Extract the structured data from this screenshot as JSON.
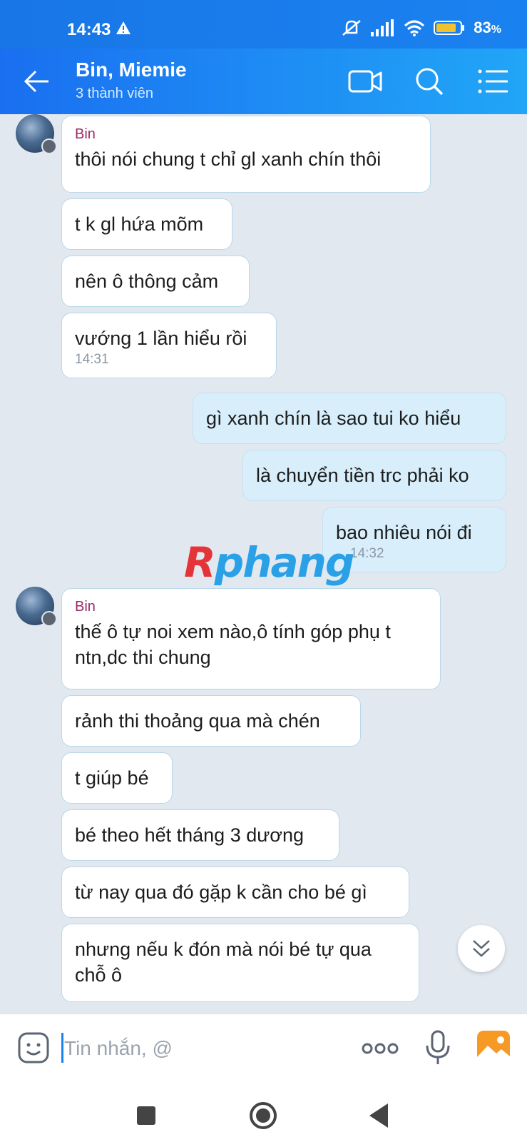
{
  "status_bar": {
    "time": "14:43",
    "battery": "83",
    "battery_unit": "%"
  },
  "header": {
    "title": "Bin, Miemie",
    "subtitle": "3 thành viên"
  },
  "watermark": {
    "first": "R",
    "rest": "phang"
  },
  "messages": [
    {
      "sender": "Bin",
      "text": "thôi nói chung t chỉ gl xanh chín thôi"
    },
    {
      "text": "t k gl hứa mõm"
    },
    {
      "text": "nên ô thông cảm"
    },
    {
      "text": "vướng 1 lần hiểu rồi",
      "time": "14:31"
    },
    {
      "text": "gì xanh chín là sao tui ko hiểu"
    },
    {
      "text": "là chuyển tiền trc phải ko"
    },
    {
      "text": "bao nhiêu nói đi",
      "time": "14:32"
    },
    {
      "sender": "Bin",
      "text": "thế ô tự noi xem nào,ô tính góp phụ t\nntn,dc thi chung"
    },
    {
      "text": "rảnh thi thoảng qua mà chén"
    },
    {
      "text": "t giúp bé"
    },
    {
      "text": "bé theo hết tháng 3 dương"
    },
    {
      "text": "từ nay qua đó gặp k cần cho bé gì"
    },
    {
      "text": "nhưng nếu k đón mà nói bé tự qua\nchỗ ô"
    }
  ],
  "input": {
    "placeholder": "Tin nhắn, @"
  },
  "colors": {
    "header_start": "#1a6ff0",
    "header_end": "#21a6f7",
    "chat_bg": "#e2e8ef",
    "sender_name": "#9c2a64",
    "my_bubble": "#d8effb"
  }
}
